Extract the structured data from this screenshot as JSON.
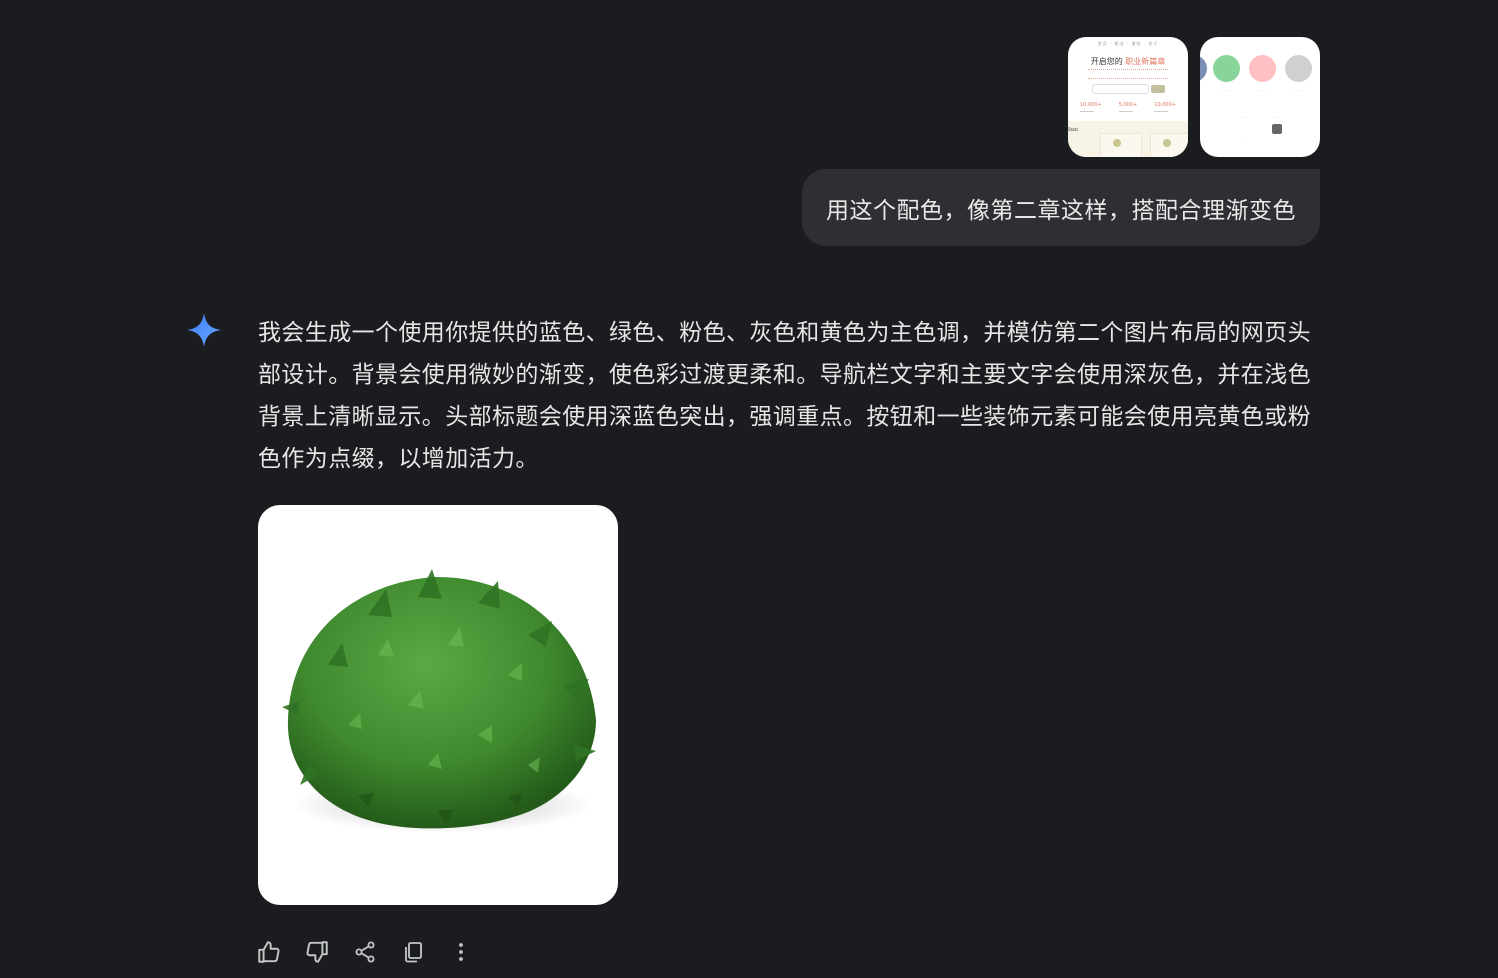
{
  "user_turn": {
    "attachments": [
      {
        "kind": "landing-page-preview",
        "nav_text": "首页 · 职业 · 课程 · 关于",
        "title_prefix": "开启您的",
        "title_highlight": "职业新篇章",
        "stats": [
          "10,000+",
          "5,000+",
          "10,000+"
        ],
        "bottom_label": "Stats"
      },
      {
        "kind": "color-palette",
        "swatch_colors": [
          "#87d59a",
          "#ffc0c4",
          "#d0d0d0"
        ],
        "edge_color": "#7a8fb3"
      }
    ],
    "message": "用这个配色，像第二章这样，搭配合理渐变色"
  },
  "assistant_turn": {
    "icon": "gemini-sparkle-icon",
    "accent_color": "#4f86f7",
    "text": "我会生成一个使用你提供的蓝色、绿色、粉色、灰色和黄色为主色调，并模仿第二个图片布局的网页头部设计。背景会使用微妙的渐变，使色彩过渡更柔和。导航栏文字和主要文字会使用深灰色，并在浅色背景上清晰显示。头部标题会使用深蓝色突出，强调重点。按钮和一些装饰元素可能会使用亮黄色或粉色作为点缀，以增加活力。",
    "image": {
      "subject": "green leafy bush on white background",
      "foliage_color": "#3f8a2e"
    },
    "actions": [
      {
        "icon": "thumbs-up-icon"
      },
      {
        "icon": "thumbs-down-icon"
      },
      {
        "icon": "share-icon"
      },
      {
        "icon": "copy-icon"
      },
      {
        "icon": "more-vertical-icon"
      }
    ]
  },
  "colors": {
    "background": "#1b1c1f",
    "user_bubble": "#2e2f33",
    "text": "#e6e6e6"
  }
}
